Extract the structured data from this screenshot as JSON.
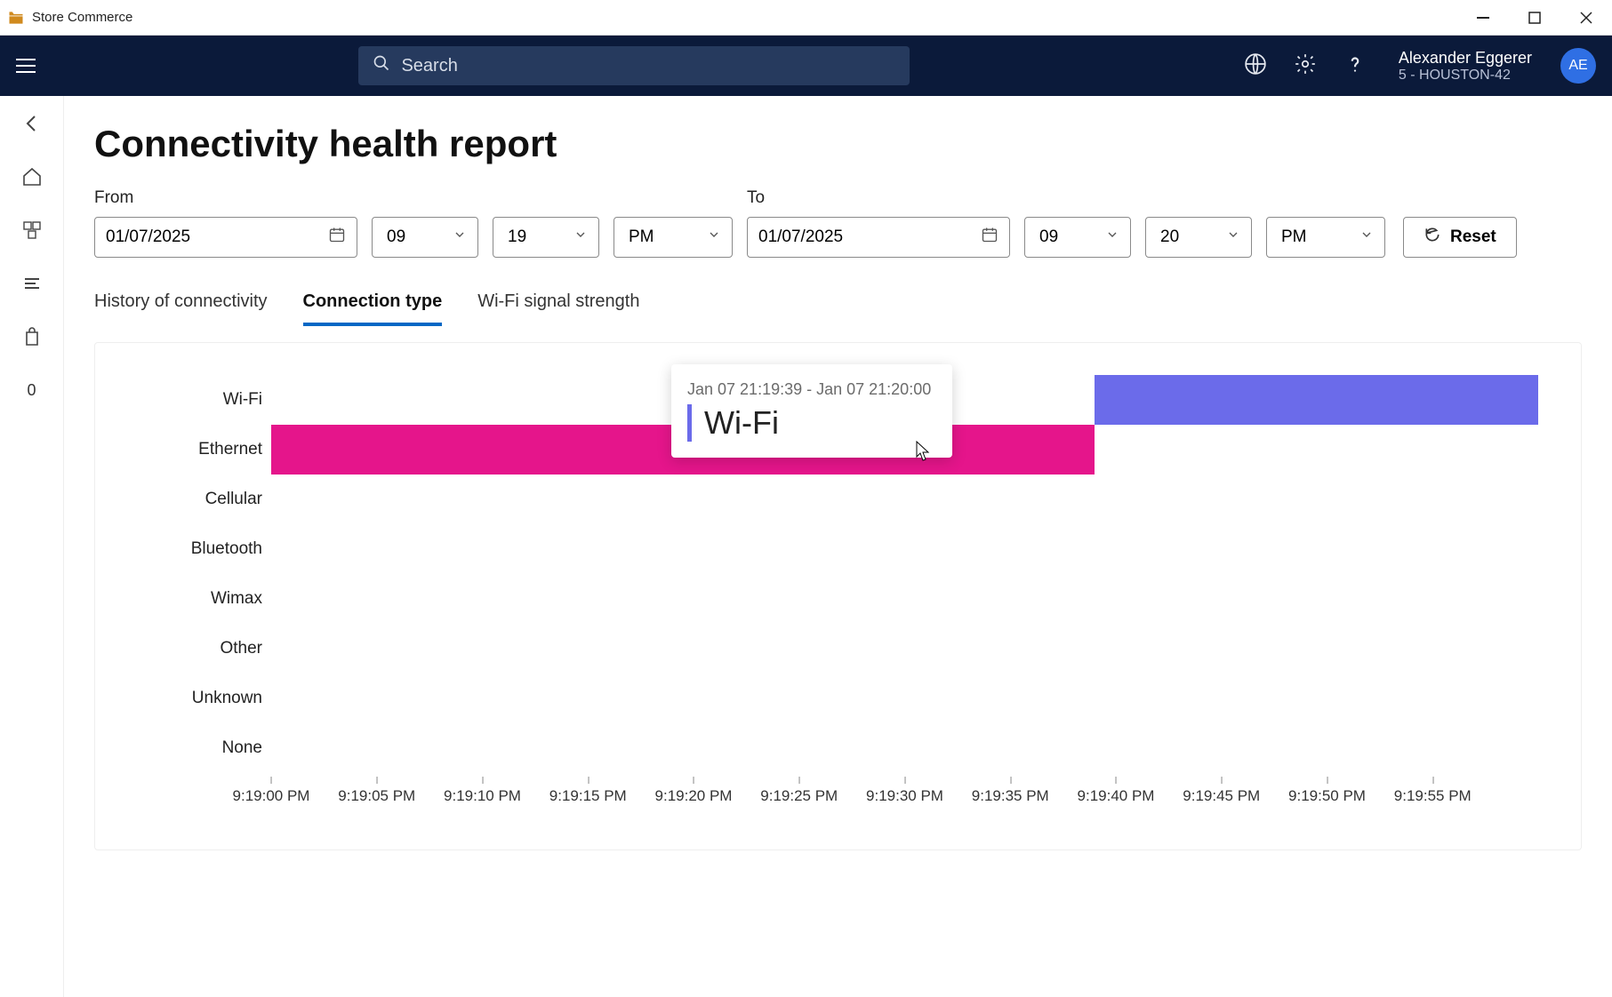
{
  "window": {
    "title": "Store Commerce"
  },
  "header": {
    "search_placeholder": "Search",
    "user_name": "Alexander Eggerer",
    "user_location": "5 - HOUSTON-42",
    "avatar_initials": "AE"
  },
  "leftnav": {
    "badge": "0"
  },
  "page": {
    "title": "Connectivity health report"
  },
  "filters": {
    "from": {
      "label": "From",
      "date": "01/07/2025",
      "hour": "09",
      "minute": "19",
      "ampm": "PM"
    },
    "to": {
      "label": "To",
      "date": "01/07/2025",
      "hour": "09",
      "minute": "20",
      "ampm": "PM"
    },
    "reset_label": "Reset"
  },
  "tabs": {
    "items": [
      "History of connectivity",
      "Connection type",
      "Wi-Fi signal strength"
    ],
    "active_index": 1
  },
  "tooltip": {
    "range": "Jan 07 21:19:39 - Jan 07 21:20:00",
    "value": "Wi-Fi"
  },
  "chart_data": {
    "type": "bar",
    "orientation": "horizontal-timeline",
    "categories": [
      "Wi-Fi",
      "Ethernet",
      "Cellular",
      "Bluetooth",
      "Wimax",
      "Other",
      "Unknown",
      "None"
    ],
    "x_ticks": [
      "9:19:00 PM",
      "9:19:05 PM",
      "9:19:10 PM",
      "9:19:15 PM",
      "9:19:20 PM",
      "9:19:25 PM",
      "9:19:30 PM",
      "9:19:35 PM",
      "9:19:40 PM",
      "9:19:45 PM",
      "9:19:50 PM",
      "9:19:55 PM"
    ],
    "x_range_seconds": [
      0,
      60
    ],
    "series": [
      {
        "category": "Ethernet",
        "start_s": 0,
        "end_s": 39,
        "color": "#e5158b"
      },
      {
        "category": "Wi-Fi",
        "start_s": 39,
        "end_s": 60,
        "color": "#6b6bea"
      }
    ],
    "title": "",
    "xlabel": "",
    "ylabel": ""
  }
}
